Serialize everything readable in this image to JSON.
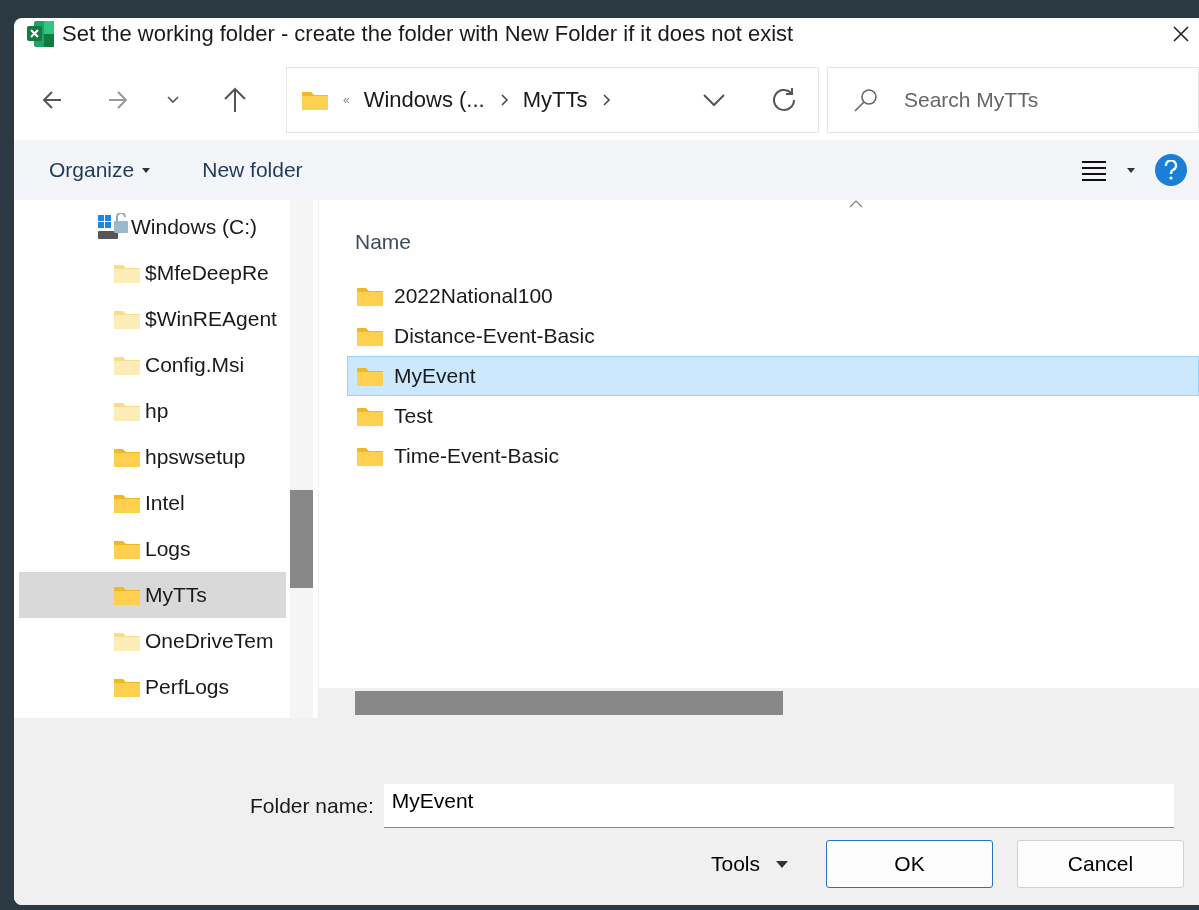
{
  "window": {
    "title": "Set the working folder - create the folder with New Folder if it does not exist"
  },
  "address_bar": {
    "overflow": "«",
    "crumbs": [
      "Windows (...",
      "MyTTs"
    ]
  },
  "search": {
    "placeholder": "Search MyTTs"
  },
  "toolbar": {
    "organize": "Organize",
    "new_folder": "New folder"
  },
  "sidebar": {
    "drive": "Windows (C:)",
    "items": [
      {
        "label": "$MfeDeepRe",
        "hidden": true,
        "selected": false
      },
      {
        "label": "$WinREAgent",
        "hidden": true,
        "selected": false
      },
      {
        "label": "Config.Msi",
        "hidden": true,
        "selected": false
      },
      {
        "label": "hp",
        "hidden": true,
        "selected": false
      },
      {
        "label": "hpswsetup",
        "hidden": false,
        "selected": false
      },
      {
        "label": "Intel",
        "hidden": false,
        "selected": false
      },
      {
        "label": "Logs",
        "hidden": false,
        "selected": false
      },
      {
        "label": "MyTTs",
        "hidden": false,
        "selected": true
      },
      {
        "label": "OneDriveTem",
        "hidden": true,
        "selected": false
      },
      {
        "label": "PerfLogs",
        "hidden": false,
        "selected": false
      }
    ]
  },
  "file_list": {
    "columns": [
      "Name"
    ],
    "rows": [
      {
        "name": "2022National100",
        "selected": false
      },
      {
        "name": "Distance-Event-Basic",
        "selected": false
      },
      {
        "name": "MyEvent",
        "selected": true
      },
      {
        "name": "Test",
        "selected": false
      },
      {
        "name": "Time-Event-Basic",
        "selected": false
      }
    ]
  },
  "footer": {
    "label": "Folder name:",
    "value": "MyEvent",
    "tools": "Tools",
    "buttons": [
      "OK",
      "Cancel"
    ]
  }
}
